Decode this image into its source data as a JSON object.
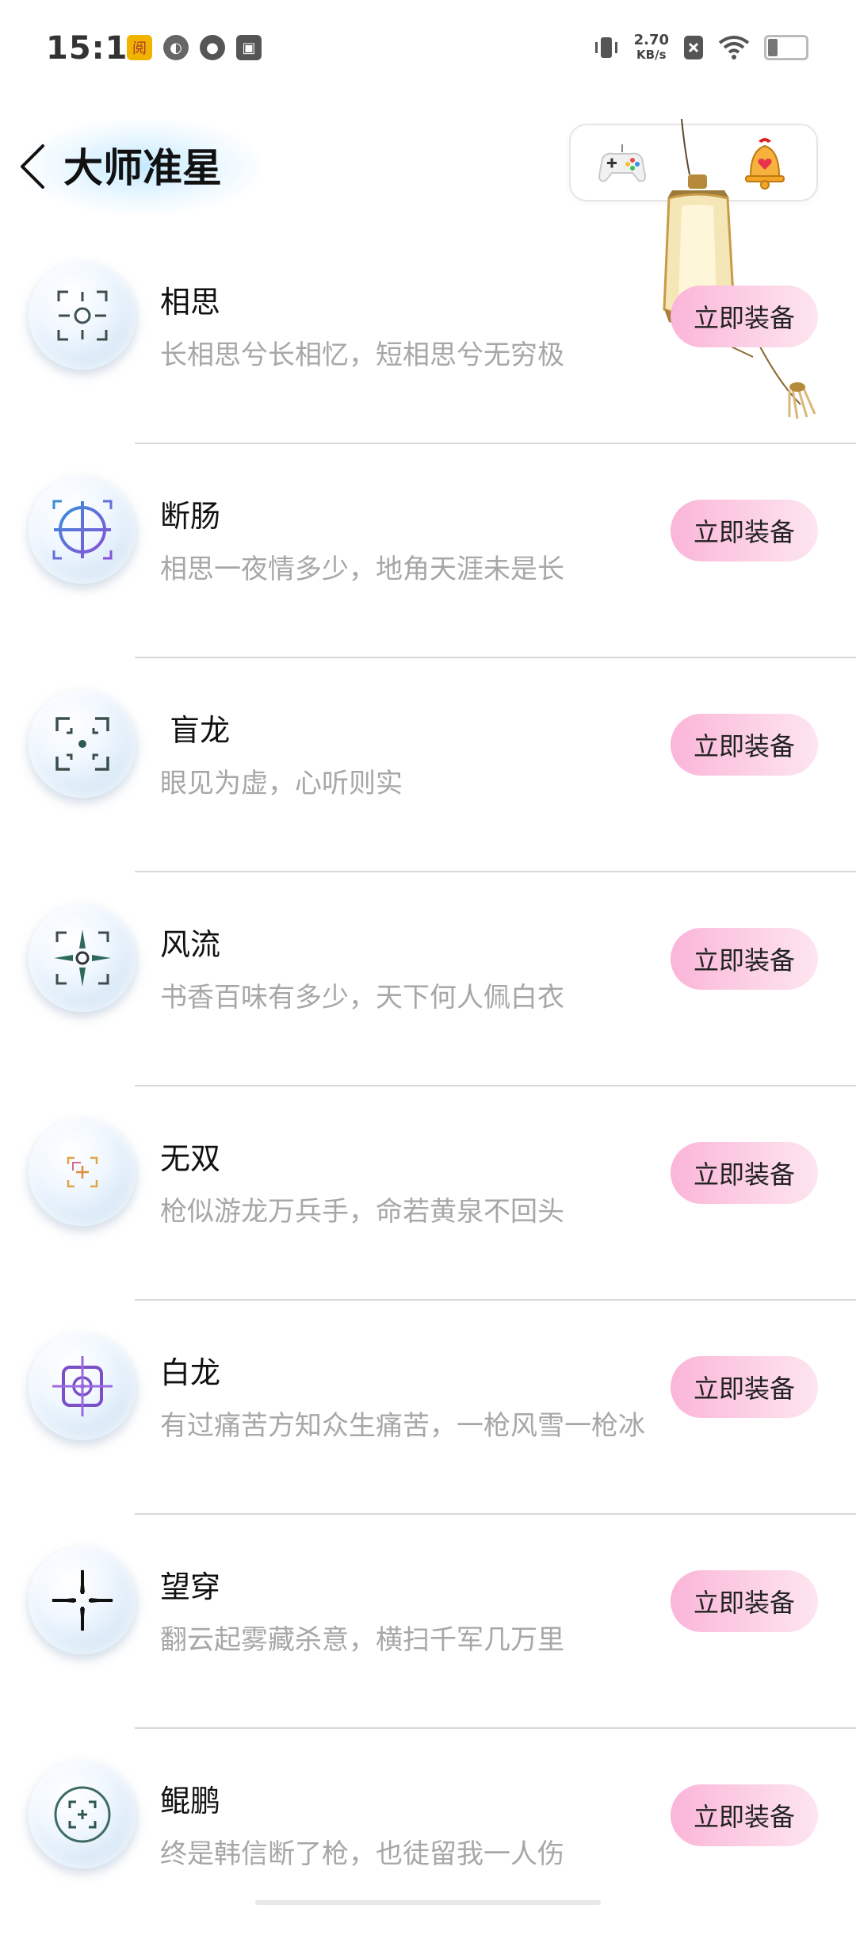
{
  "status_bar": {
    "time": "15:11",
    "net_speed_value": "2.70",
    "net_speed_unit": "KB/s",
    "left_icons": [
      "reader-app-icon",
      "leaf-app-icon",
      "cat-app-icon",
      "archive-app-icon"
    ],
    "right_icons": [
      "vibrate-icon",
      "sim-off-icon",
      "wifi-icon",
      "battery-icon"
    ]
  },
  "header": {
    "title": "大师准星",
    "icons": [
      "gamepad-icon",
      "bell-icon"
    ]
  },
  "colors": {
    "button_gradient_start": "#fbb5d9",
    "button_gradient_end": "#fde5ef",
    "subtitle": "#a7a7a7",
    "divider": "#d8d8d8"
  },
  "crosshairs": [
    {
      "name": "相思",
      "desc": "长相思兮长相忆，短相思兮无穷极",
      "button": "立即装备",
      "icon": "circle-crosshair-icon"
    },
    {
      "name": "断肠",
      "desc": "相思一夜情多少，地角天涯未是长",
      "button": "立即装备",
      "icon": "target-crosshair-icon"
    },
    {
      "name": " 盲龙",
      "desc": "眼见为虚，心听则实",
      "button": "立即装备",
      "icon": "dot-crosshair-icon"
    },
    {
      "name": "风流",
      "desc": "书香百味有多少，天下何人佩白衣",
      "button": "立即装备",
      "icon": "arrow-crosshair-icon"
    },
    {
      "name": "无双",
      "desc": "枪似游龙万兵手，命若黄泉不回头",
      "button": "立即装备",
      "icon": "square-crosshair-icon"
    },
    {
      "name": "白龙",
      "desc": "有过痛苦方知众生痛苦，一枪风雪一枪冰",
      "button": "立即装备",
      "icon": "purple-crosshair-icon"
    },
    {
      "name": "望穿",
      "desc": "翻云起雾藏杀意，横扫千军几万里",
      "button": "立即装备",
      "icon": "cross-crosshair-icon"
    },
    {
      "name": "鲲鹏",
      "desc": "终是韩信断了枪，也徒留我一人伤",
      "button": "立即装备",
      "icon": "bracket-crosshair-icon"
    }
  ]
}
